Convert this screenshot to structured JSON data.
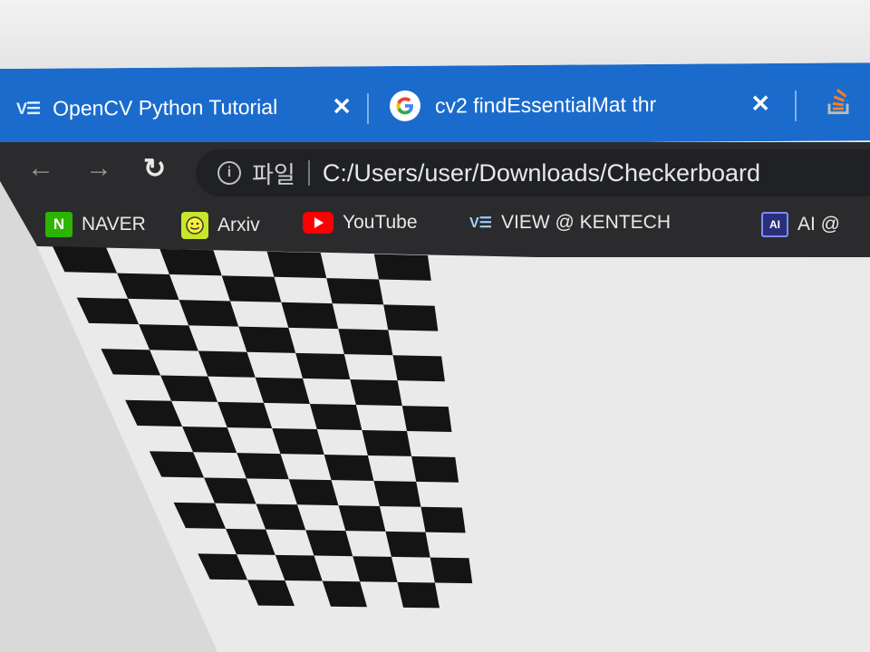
{
  "tabs": [
    {
      "favicon": "ve-logo-icon",
      "title": "OpenCV Python Tutorial",
      "close": "✕"
    },
    {
      "favicon": "google-icon",
      "title": "cv2 findEssentialMat thr",
      "close": "✕"
    },
    {
      "favicon": "stackoverflow-icon",
      "title": ""
    }
  ],
  "toolbar": {
    "back": "←",
    "forward": "→",
    "reload": "↻",
    "info": "i",
    "scheme_label": "파일",
    "url": "C:/Users/user/Downloads/Checkerboard"
  },
  "bookmarks": [
    {
      "icon": "naver-icon",
      "icon_text": "N",
      "label": "NAVER"
    },
    {
      "icon": "arxiv-icon",
      "label": "Arxiv"
    },
    {
      "icon": "youtube-icon",
      "label": "YouTube"
    },
    {
      "icon": "ve-logo-icon",
      "label": "VIEW @ KENTECH"
    },
    {
      "icon": "ai-icon",
      "icon_text": "AI",
      "label": "AI @"
    }
  ],
  "page": {
    "content": "checkerboard-image",
    "pattern_colors": {
      "dark": "#141414",
      "light": "#f3f3f3"
    }
  },
  "colors": {
    "tabstrip": "#1a6bcc",
    "toolbar": "#2b2b2d",
    "omnibox": "#202124"
  }
}
